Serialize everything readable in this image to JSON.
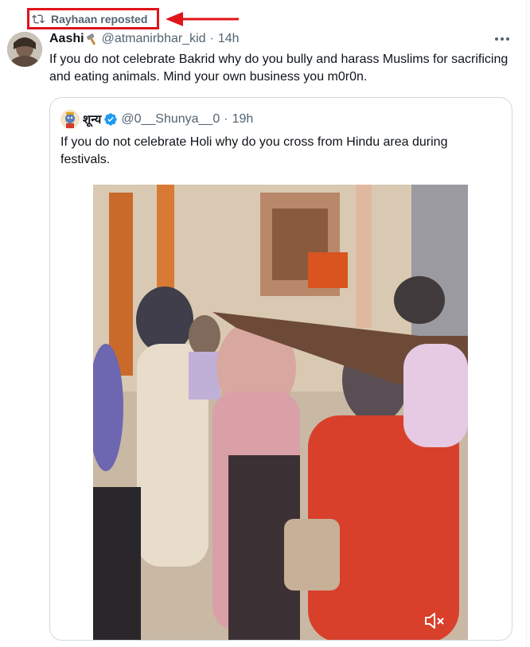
{
  "repost": {
    "label": "Rayhaan reposted"
  },
  "tweet": {
    "author_name": "Aashi",
    "author_emoji": "hammer-icon",
    "handle": "@atmanirbhar_kid",
    "separator": "·",
    "time": "14h",
    "text": "If you do not celebrate Bakrid why do you bully and harass Muslims for sacrificing and eating animals. Mind your own business you m0r0n."
  },
  "quoted": {
    "author_name": "शून्य",
    "handle": "@0__Shunya__0",
    "separator": "·",
    "time": "19h",
    "text": "If you do not celebrate Holi why do you cross from Hindu area during festivals."
  },
  "colors": {
    "annotation": "#e0141a",
    "secondary_text": "#536471",
    "verified": "#1d9bf0",
    "border": "#cfd9de"
  }
}
